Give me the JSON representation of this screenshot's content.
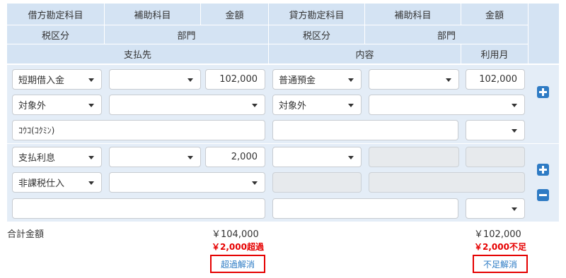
{
  "headers": {
    "debit_account": "借方勘定科目",
    "debit_sub": "補助科目",
    "debit_amount": "金額",
    "credit_account": "貸方勘定科目",
    "credit_sub": "補助科目",
    "credit_amount": "金額",
    "debit_tax": "税区分",
    "debit_dept": "部門",
    "credit_tax": "税区分",
    "credit_dept": "部門",
    "payee": "支払先",
    "content": "内容",
    "usage_month": "利用月"
  },
  "rows": [
    {
      "debit_account": "短期借入金",
      "debit_sub": "",
      "debit_amount": "102,000",
      "credit_account": "普通預金",
      "credit_sub": "",
      "credit_amount": "102,000",
      "debit_tax": "対象外",
      "debit_dept": "",
      "credit_tax": "対象外",
      "credit_dept": "",
      "payee": "ｺｳｺ(ｺｸﾐﾝ)",
      "content": "",
      "usage_month": ""
    },
    {
      "debit_account": "支払利息",
      "debit_sub": "",
      "debit_amount": "2,000",
      "credit_account": "",
      "debit_tax": "非課税仕入",
      "debit_dept": "",
      "payee": "",
      "content": "",
      "usage_month": ""
    }
  ],
  "totals": {
    "label": "合計金額",
    "debit_total": "￥104,000",
    "credit_total": "￥102,000",
    "debit_diff": "￥2,000超過",
    "credit_diff": "￥2,000不足",
    "debit_resolve": "超過解消",
    "credit_resolve": "不足解消"
  },
  "icons": {
    "add": "plus-icon",
    "remove": "minus-icon"
  },
  "colors": {
    "header_bg": "#d4e3f3",
    "row_bg": "#e4edf7",
    "accent": "#2e7bc4",
    "alert": "#e60000"
  }
}
